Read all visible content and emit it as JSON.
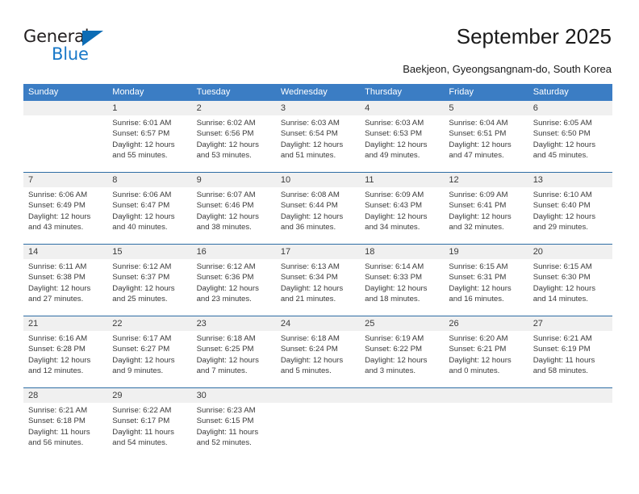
{
  "brand": {
    "name_primary": "General",
    "name_secondary": "Blue",
    "triangle_color": "#0c6cb5",
    "blue_color": "#1878c8"
  },
  "header": {
    "title": "September 2025",
    "subtitle": "Baekjeon, Gyeongsangnam-do, South Korea"
  },
  "theme": {
    "header_bg": "#3b7dc4",
    "row_band_bg": "#f0f0f0",
    "separator": "#2e6da4",
    "text": "#3a3a3a"
  },
  "calendar": {
    "weekdays": [
      "Sunday",
      "Monday",
      "Tuesday",
      "Wednesday",
      "Thursday",
      "Friday",
      "Saturday"
    ],
    "weeks": [
      [
        {
          "day": "",
          "lines": []
        },
        {
          "day": "1",
          "lines": [
            "Sunrise: 6:01 AM",
            "Sunset: 6:57 PM",
            "Daylight: 12 hours",
            "and 55 minutes."
          ]
        },
        {
          "day": "2",
          "lines": [
            "Sunrise: 6:02 AM",
            "Sunset: 6:56 PM",
            "Daylight: 12 hours",
            "and 53 minutes."
          ]
        },
        {
          "day": "3",
          "lines": [
            "Sunrise: 6:03 AM",
            "Sunset: 6:54 PM",
            "Daylight: 12 hours",
            "and 51 minutes."
          ]
        },
        {
          "day": "4",
          "lines": [
            "Sunrise: 6:03 AM",
            "Sunset: 6:53 PM",
            "Daylight: 12 hours",
            "and 49 minutes."
          ]
        },
        {
          "day": "5",
          "lines": [
            "Sunrise: 6:04 AM",
            "Sunset: 6:51 PM",
            "Daylight: 12 hours",
            "and 47 minutes."
          ]
        },
        {
          "day": "6",
          "lines": [
            "Sunrise: 6:05 AM",
            "Sunset: 6:50 PM",
            "Daylight: 12 hours",
            "and 45 minutes."
          ]
        }
      ],
      [
        {
          "day": "7",
          "lines": [
            "Sunrise: 6:06 AM",
            "Sunset: 6:49 PM",
            "Daylight: 12 hours",
            "and 43 minutes."
          ]
        },
        {
          "day": "8",
          "lines": [
            "Sunrise: 6:06 AM",
            "Sunset: 6:47 PM",
            "Daylight: 12 hours",
            "and 40 minutes."
          ]
        },
        {
          "day": "9",
          "lines": [
            "Sunrise: 6:07 AM",
            "Sunset: 6:46 PM",
            "Daylight: 12 hours",
            "and 38 minutes."
          ]
        },
        {
          "day": "10",
          "lines": [
            "Sunrise: 6:08 AM",
            "Sunset: 6:44 PM",
            "Daylight: 12 hours",
            "and 36 minutes."
          ]
        },
        {
          "day": "11",
          "lines": [
            "Sunrise: 6:09 AM",
            "Sunset: 6:43 PM",
            "Daylight: 12 hours",
            "and 34 minutes."
          ]
        },
        {
          "day": "12",
          "lines": [
            "Sunrise: 6:09 AM",
            "Sunset: 6:41 PM",
            "Daylight: 12 hours",
            "and 32 minutes."
          ]
        },
        {
          "day": "13",
          "lines": [
            "Sunrise: 6:10 AM",
            "Sunset: 6:40 PM",
            "Daylight: 12 hours",
            "and 29 minutes."
          ]
        }
      ],
      [
        {
          "day": "14",
          "lines": [
            "Sunrise: 6:11 AM",
            "Sunset: 6:38 PM",
            "Daylight: 12 hours",
            "and 27 minutes."
          ]
        },
        {
          "day": "15",
          "lines": [
            "Sunrise: 6:12 AM",
            "Sunset: 6:37 PM",
            "Daylight: 12 hours",
            "and 25 minutes."
          ]
        },
        {
          "day": "16",
          "lines": [
            "Sunrise: 6:12 AM",
            "Sunset: 6:36 PM",
            "Daylight: 12 hours",
            "and 23 minutes."
          ]
        },
        {
          "day": "17",
          "lines": [
            "Sunrise: 6:13 AM",
            "Sunset: 6:34 PM",
            "Daylight: 12 hours",
            "and 21 minutes."
          ]
        },
        {
          "day": "18",
          "lines": [
            "Sunrise: 6:14 AM",
            "Sunset: 6:33 PM",
            "Daylight: 12 hours",
            "and 18 minutes."
          ]
        },
        {
          "day": "19",
          "lines": [
            "Sunrise: 6:15 AM",
            "Sunset: 6:31 PM",
            "Daylight: 12 hours",
            "and 16 minutes."
          ]
        },
        {
          "day": "20",
          "lines": [
            "Sunrise: 6:15 AM",
            "Sunset: 6:30 PM",
            "Daylight: 12 hours",
            "and 14 minutes."
          ]
        }
      ],
      [
        {
          "day": "21",
          "lines": [
            "Sunrise: 6:16 AM",
            "Sunset: 6:28 PM",
            "Daylight: 12 hours",
            "and 12 minutes."
          ]
        },
        {
          "day": "22",
          "lines": [
            "Sunrise: 6:17 AM",
            "Sunset: 6:27 PM",
            "Daylight: 12 hours",
            "and 9 minutes."
          ]
        },
        {
          "day": "23",
          "lines": [
            "Sunrise: 6:18 AM",
            "Sunset: 6:25 PM",
            "Daylight: 12 hours",
            "and 7 minutes."
          ]
        },
        {
          "day": "24",
          "lines": [
            "Sunrise: 6:18 AM",
            "Sunset: 6:24 PM",
            "Daylight: 12 hours",
            "and 5 minutes."
          ]
        },
        {
          "day": "25",
          "lines": [
            "Sunrise: 6:19 AM",
            "Sunset: 6:22 PM",
            "Daylight: 12 hours",
            "and 3 minutes."
          ]
        },
        {
          "day": "26",
          "lines": [
            "Sunrise: 6:20 AM",
            "Sunset: 6:21 PM",
            "Daylight: 12 hours",
            "and 0 minutes."
          ]
        },
        {
          "day": "27",
          "lines": [
            "Sunrise: 6:21 AM",
            "Sunset: 6:19 PM",
            "Daylight: 11 hours",
            "and 58 minutes."
          ]
        }
      ],
      [
        {
          "day": "28",
          "lines": [
            "Sunrise: 6:21 AM",
            "Sunset: 6:18 PM",
            "Daylight: 11 hours",
            "and 56 minutes."
          ]
        },
        {
          "day": "29",
          "lines": [
            "Sunrise: 6:22 AM",
            "Sunset: 6:17 PM",
            "Daylight: 11 hours",
            "and 54 minutes."
          ]
        },
        {
          "day": "30",
          "lines": [
            "Sunrise: 6:23 AM",
            "Sunset: 6:15 PM",
            "Daylight: 11 hours",
            "and 52 minutes."
          ]
        },
        {
          "day": "",
          "lines": []
        },
        {
          "day": "",
          "lines": []
        },
        {
          "day": "",
          "lines": []
        },
        {
          "day": "",
          "lines": []
        }
      ]
    ]
  }
}
